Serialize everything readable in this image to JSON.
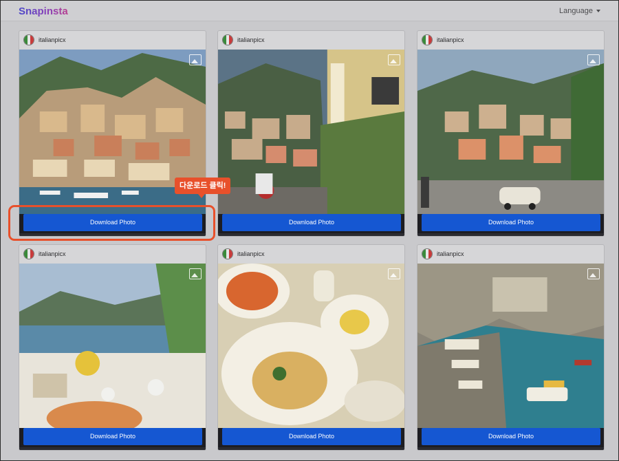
{
  "header": {
    "brand": "Snapinsta",
    "language_label": "Language"
  },
  "callout": {
    "text": "다운로드 클릭!"
  },
  "colors": {
    "accent": "#1557d2",
    "callout": "#e8502b",
    "brand_start": "#4a47c9",
    "brand_end": "#b83f8f"
  },
  "posts": [
    {
      "username": "italianpicx",
      "button_label": "Download Photo",
      "icon": "image-icon",
      "photo": "positano-cliffside-village"
    },
    {
      "username": "italianpicx",
      "button_label": "Download Photo",
      "icon": "image-icon",
      "photo": "positano-street-vespa"
    },
    {
      "username": "italianpicx",
      "button_label": "Download Photo",
      "icon": "image-icon",
      "photo": "positano-view-fiat500"
    },
    {
      "username": "italianpicx",
      "button_label": "Download Photo",
      "icon": "image-icon",
      "photo": "seaside-dinner-table"
    },
    {
      "username": "italianpicx",
      "button_label": "Download Photo",
      "icon": "image-icon",
      "photo": "pasta-plates-table"
    },
    {
      "username": "italianpicx",
      "button_label": "Download Photo",
      "icon": "image-icon",
      "photo": "amalfi-coast-beach"
    }
  ]
}
